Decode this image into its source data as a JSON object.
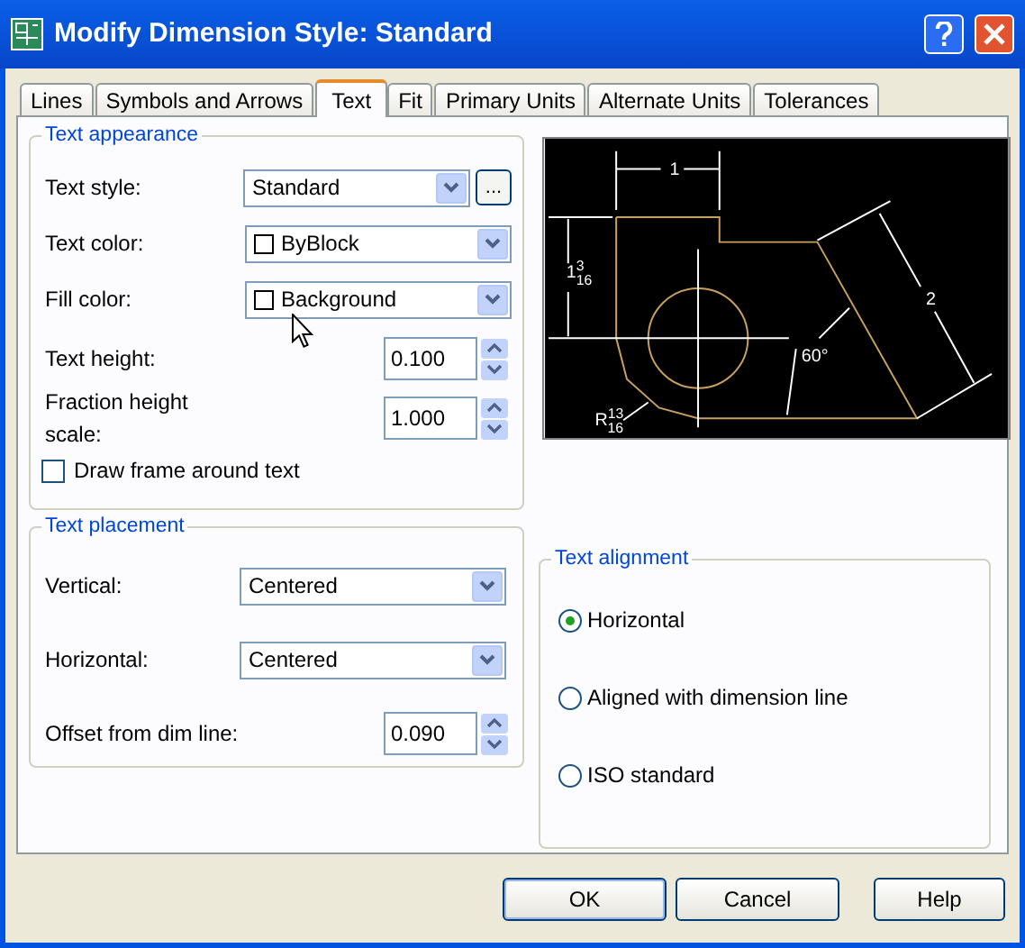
{
  "window": {
    "title": "Modify Dimension Style: Standard"
  },
  "tabs": [
    {
      "label": "Lines",
      "selected": false
    },
    {
      "label": "Symbols and Arrows",
      "selected": false
    },
    {
      "label": "Text",
      "selected": true
    },
    {
      "label": "Fit",
      "selected": false
    },
    {
      "label": "Primary Units",
      "selected": false
    },
    {
      "label": "Alternate Units",
      "selected": false
    },
    {
      "label": "Tolerances",
      "selected": false
    }
  ],
  "text_appearance": {
    "title": "Text appearance",
    "rows": [
      {
        "kind": "dropdown",
        "label": "Text style:",
        "value": "Standard",
        "browse": "..."
      },
      {
        "kind": "color",
        "label": "Text color:",
        "value": "ByBlock"
      },
      {
        "kind": "color",
        "label": "Fill color:",
        "value": "Background"
      },
      {
        "kind": "spinner",
        "label": "Text height:",
        "value": "0.100"
      },
      {
        "kind": "spinner",
        "label": "Fraction height scale:",
        "value": "1.000"
      }
    ],
    "frame_checkbox": {
      "label": "Draw frame around text",
      "checked": false
    }
  },
  "preview": {
    "labels": [
      {
        "whole": "1"
      },
      {
        "whole": "1",
        "num": "3",
        "den": "16"
      },
      {
        "whole": "2"
      },
      {
        "whole": "60°"
      },
      {
        "whole": "R",
        "num": "13",
        "den": "16"
      }
    ]
  },
  "text_placement": {
    "title": "Text placement",
    "rows": [
      {
        "kind": "dropdown",
        "label": "Vertical:",
        "value": "Centered"
      },
      {
        "kind": "dropdown",
        "label": "Horizontal:",
        "value": "Centered"
      },
      {
        "kind": "spinner",
        "label": "Offset from dim line:",
        "value": "0.090"
      }
    ]
  },
  "text_alignment": {
    "title": "Text alignment",
    "options": [
      {
        "label": "Horizontal",
        "selected": true
      },
      {
        "label": "Aligned with dimension line",
        "selected": false
      },
      {
        "label": "ISO standard",
        "selected": false
      }
    ]
  },
  "buttons": [
    "OK",
    "Cancel",
    "Help"
  ]
}
